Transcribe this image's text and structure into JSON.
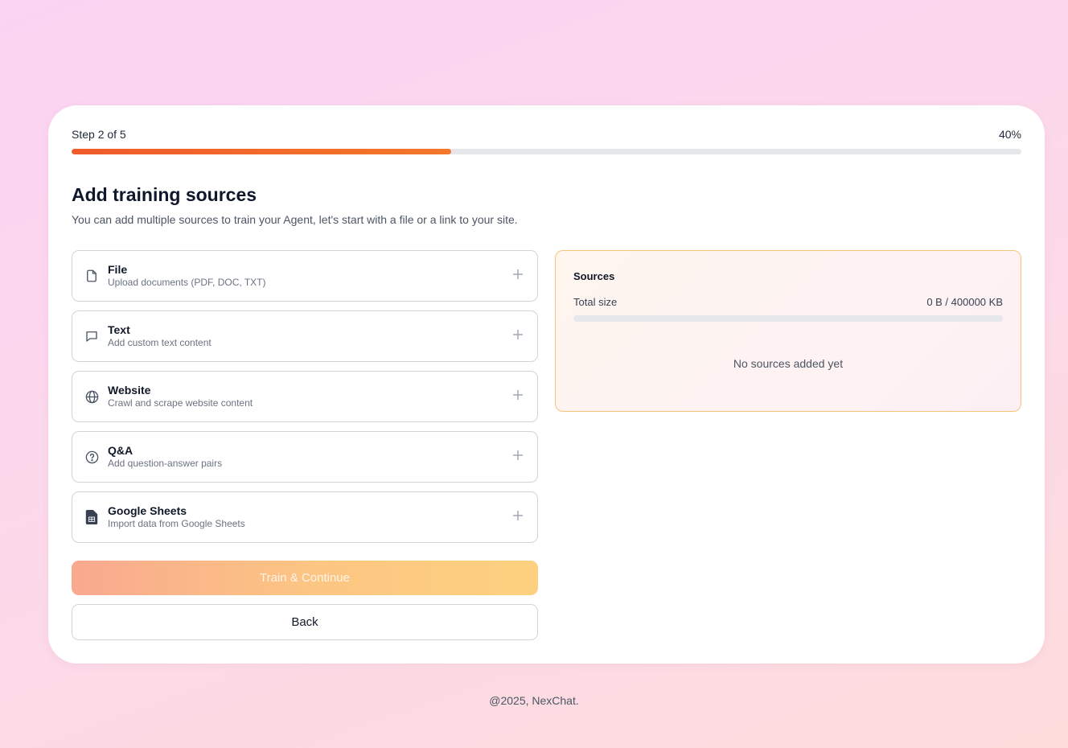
{
  "progress": {
    "step_label": "Step 2 of 5",
    "percent_label": "40%",
    "fraction": 0.4,
    "accent_color": "#f2782a"
  },
  "header": {
    "title": "Add training sources",
    "subtitle": "You can add multiple sources to train your Agent, let's start with a file or a link to your site."
  },
  "sources": [
    {
      "name": "File",
      "description": "Upload documents (PDF, DOC, TXT)",
      "icon": "file-icon"
    },
    {
      "name": "Text",
      "description": "Add custom text content",
      "icon": "message-icon"
    },
    {
      "name": "Website",
      "description": "Crawl and scrape website content",
      "icon": "globe-icon"
    },
    {
      "name": "Q&A",
      "description": "Add question-answer pairs",
      "icon": "question-icon"
    },
    {
      "name": "Google Sheets",
      "description": "Import data from Google Sheets",
      "icon": "sheets-icon"
    }
  ],
  "actions": {
    "train_label": "Train & Continue",
    "back_label": "Back"
  },
  "panel": {
    "title": "Sources",
    "size_label": "Total size",
    "size_value": "0 B / 400000 KB",
    "size_fraction": 0,
    "empty_text": "No sources added yet"
  },
  "footer": {
    "text": "@2025, NexChat."
  }
}
